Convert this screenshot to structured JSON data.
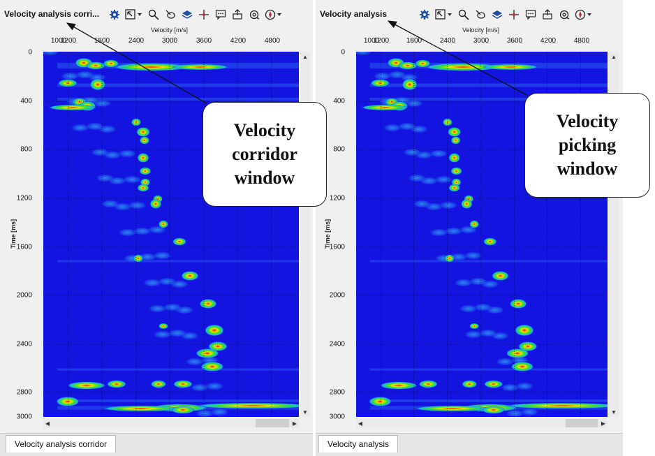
{
  "left": {
    "title": "Velocity analysis corri...",
    "tab": "Velocity analysis corridor",
    "callout": [
      "Velocity",
      "corridor",
      "window"
    ]
  },
  "right": {
    "title": "Velocity analysis",
    "tab": "Velocity analysis",
    "callout": [
      "Velocity",
      "picking",
      "window"
    ]
  },
  "axis": {
    "x_title": "Velocity [m/s]",
    "x_ticks": [
      "1000",
      "1200",
      "1800",
      "2400",
      "3000",
      "3600",
      "4200",
      "4800"
    ],
    "y_title": "Time [ms]",
    "y_ticks": [
      "0",
      "400",
      "800",
      "1200",
      "1600",
      "2000",
      "2400",
      "2800",
      "3000"
    ]
  },
  "colors": {
    "background": "#1414e0",
    "grid": "#000000"
  },
  "toolbar_icons": [
    "gear-icon",
    "select-region-icon",
    "zoom-icon",
    "pan-icon",
    "layers-icon",
    "crosshair-icon",
    "comment-icon",
    "export-icon",
    "fit-icon",
    "compass-icon"
  ]
}
